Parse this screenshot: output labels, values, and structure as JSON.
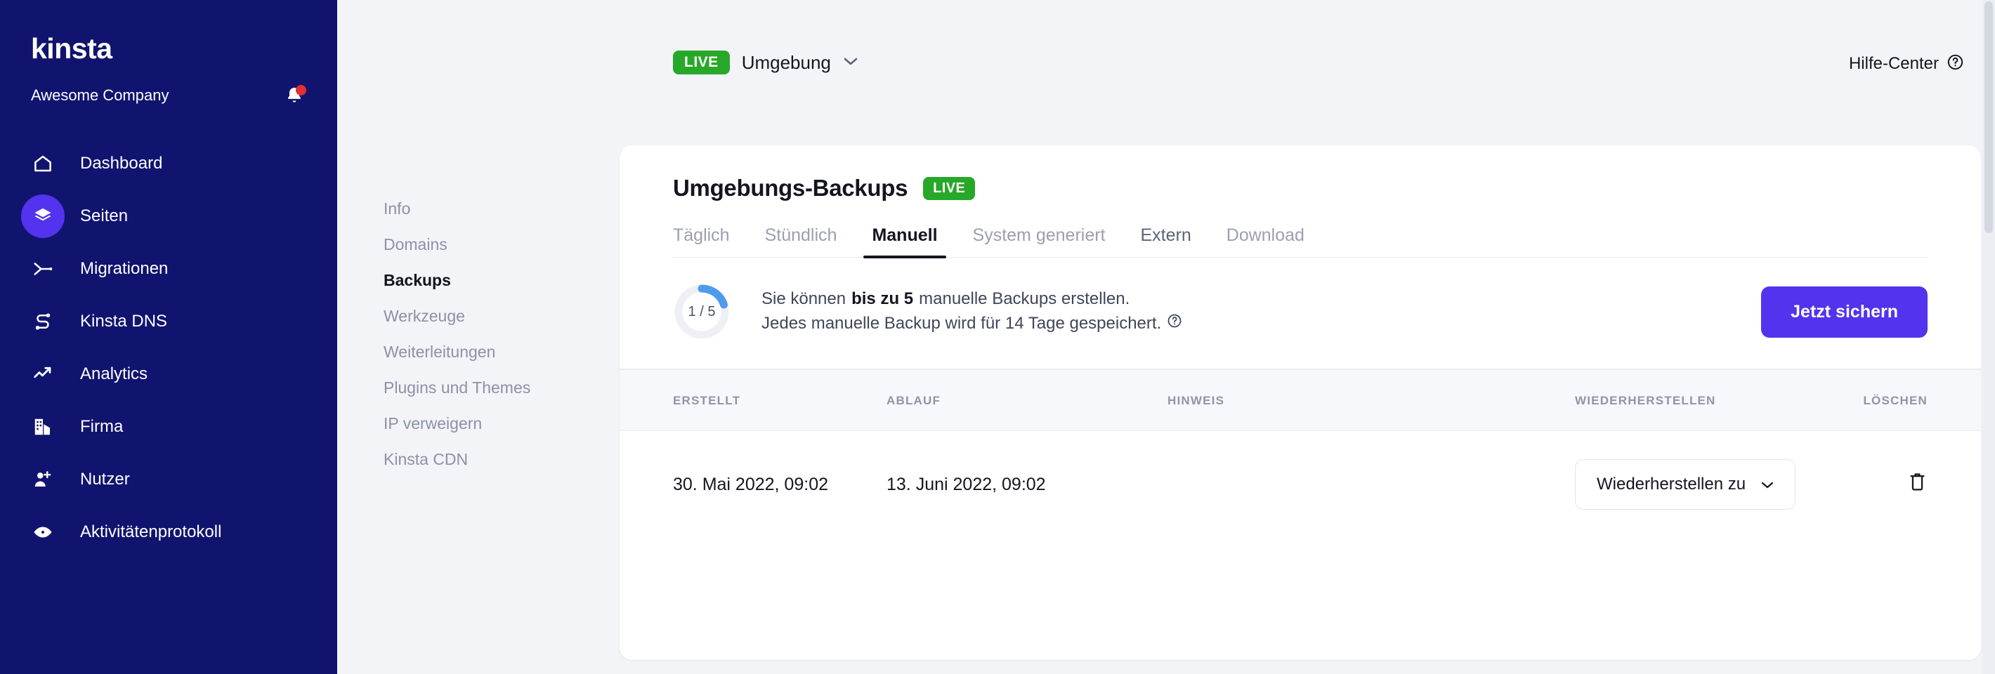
{
  "sidebar": {
    "logo": "kinsta",
    "company": "Awesome Company",
    "notification_icon": "bell-icon",
    "has_notification_dot": true,
    "items": [
      {
        "label": "Dashboard",
        "icon": "home-icon",
        "active": false
      },
      {
        "label": "Seiten",
        "icon": "layers-icon",
        "active": true
      },
      {
        "label": "Migrationen",
        "icon": "migration-icon",
        "active": false
      },
      {
        "label": "Kinsta DNS",
        "icon": "dns-icon",
        "active": false
      },
      {
        "label": "Analytics",
        "icon": "trend-up-icon",
        "active": false
      },
      {
        "label": "Firma",
        "icon": "building-icon",
        "active": false
      },
      {
        "label": "Nutzer",
        "icon": "user-plus-icon",
        "active": false
      },
      {
        "label": "Aktivitätenprotokoll",
        "icon": "eye-icon",
        "active": false
      }
    ]
  },
  "subnav": {
    "items": [
      {
        "label": "Info",
        "active": false
      },
      {
        "label": "Domains",
        "active": false
      },
      {
        "label": "Backups",
        "active": true
      },
      {
        "label": "Werkzeuge",
        "active": false
      },
      {
        "label": "Weiterleitungen",
        "active": false
      },
      {
        "label": "Plugins und Themes",
        "active": false
      },
      {
        "label": "IP verweigern",
        "active": false
      },
      {
        "label": "Kinsta CDN",
        "active": false
      }
    ]
  },
  "topbar": {
    "env_badge": "LIVE",
    "env_label": "Umgebung",
    "env_chevron_icon": "chevron-down-icon",
    "help_label": "Hilfe-Center",
    "help_icon": "question-circle-icon"
  },
  "card": {
    "title": "Umgebungs-Backups",
    "badge": "LIVE",
    "tabs": [
      {
        "label": "Täglich",
        "state": "inactive"
      },
      {
        "label": "Stündlich",
        "state": "inactive"
      },
      {
        "label": "Manuell",
        "state": "active"
      },
      {
        "label": "System generiert",
        "state": "inactive"
      },
      {
        "label": "Extern",
        "state": "hover"
      },
      {
        "label": "Download",
        "state": "inactive"
      }
    ],
    "quota": {
      "used": 1,
      "total": 5,
      "ring_label": "1 / 5",
      "ring_color": "#4d9bec",
      "ring_track_color": "#eef0f6"
    },
    "info_line_1_prefix": "Sie können ",
    "info_line_1_strong": "bis zu 5",
    "info_line_1_suffix": " manuelle Backups erstellen.",
    "info_line_2": "Jedes manuelle Backup wird für 14 Tage gespeichert.",
    "info_line_2_icon": "question-circle-icon",
    "primary_button": "Jetzt sichern",
    "primary_button_color": "#5333ed"
  },
  "table": {
    "columns": [
      "ERSTELLT",
      "ABLAUF",
      "HINWEIS",
      "WIEDERHERSTELLEN",
      "LÖSCHEN"
    ],
    "rows": [
      {
        "erstellt": "30. Mai 2022, 09:02",
        "ablauf": "13. Juni 2022, 09:02",
        "hinweis": "",
        "restore_label": "Wiederherstellen zu",
        "restore_chevron_icon": "chevron-down-icon",
        "delete_icon": "trash-icon"
      }
    ]
  }
}
